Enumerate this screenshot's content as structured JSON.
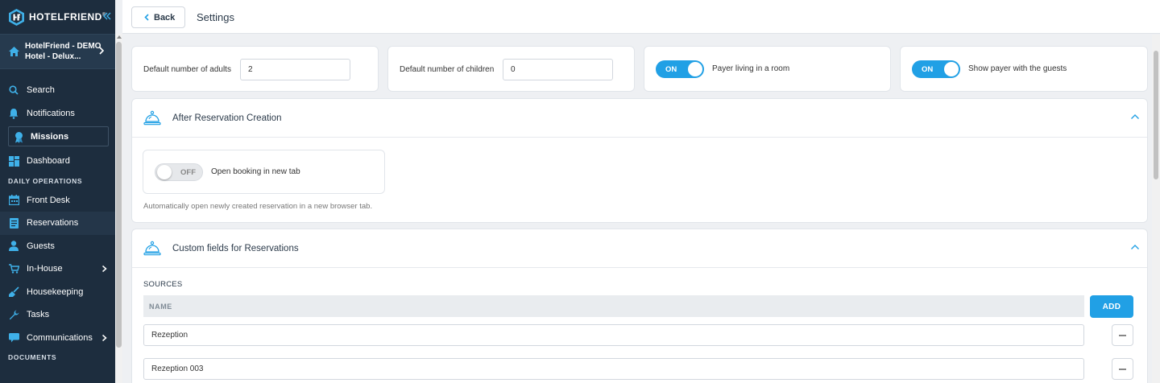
{
  "app": {
    "brand": "HOTELFRIEND",
    "brand_mark": "®"
  },
  "hotel": {
    "line1": "HotelFriend - DEMO",
    "line2": "Hotel - Delux..."
  },
  "sidebar": {
    "search": "Search",
    "notifications": "Notifications",
    "missions": "Missions",
    "dashboard": "Dashboard",
    "section_daily": "DAILY OPERATIONS",
    "items": [
      {
        "label": "Front Desk"
      },
      {
        "label": "Reservations"
      },
      {
        "label": "Guests"
      },
      {
        "label": "In-House"
      },
      {
        "label": "Housekeeping"
      },
      {
        "label": "Tasks"
      },
      {
        "label": "Communications"
      }
    ],
    "section_documents": "DOCUMENTS"
  },
  "header": {
    "back_label": "Back",
    "title": "Settings"
  },
  "defaults": {
    "adults_label": "Default number of adults",
    "adults_value": "2",
    "children_label": "Default number of children",
    "children_value": "0",
    "payer_living_label": "Payer living in a room",
    "payer_living_state": "ON",
    "show_payer_label": "Show payer with the guests",
    "show_payer_state": "ON"
  },
  "after_reservation": {
    "title": "After Reservation Creation",
    "open_tab_label": "Open booking in new tab",
    "open_tab_state": "OFF",
    "description": "Automatically open newly created reservation in a new browser tab."
  },
  "custom_fields": {
    "title": "Custom fields for Reservations",
    "sources_label": "SOURCES",
    "name_header": "NAME",
    "add_label": "ADD",
    "sources": [
      {
        "value": "Rezeption"
      },
      {
        "value": "Rezeption 003"
      }
    ]
  },
  "colors": {
    "sidebar_bg": "#1d2d3e",
    "accent": "#21a0e5",
    "page_bg": "#eef0f3"
  }
}
